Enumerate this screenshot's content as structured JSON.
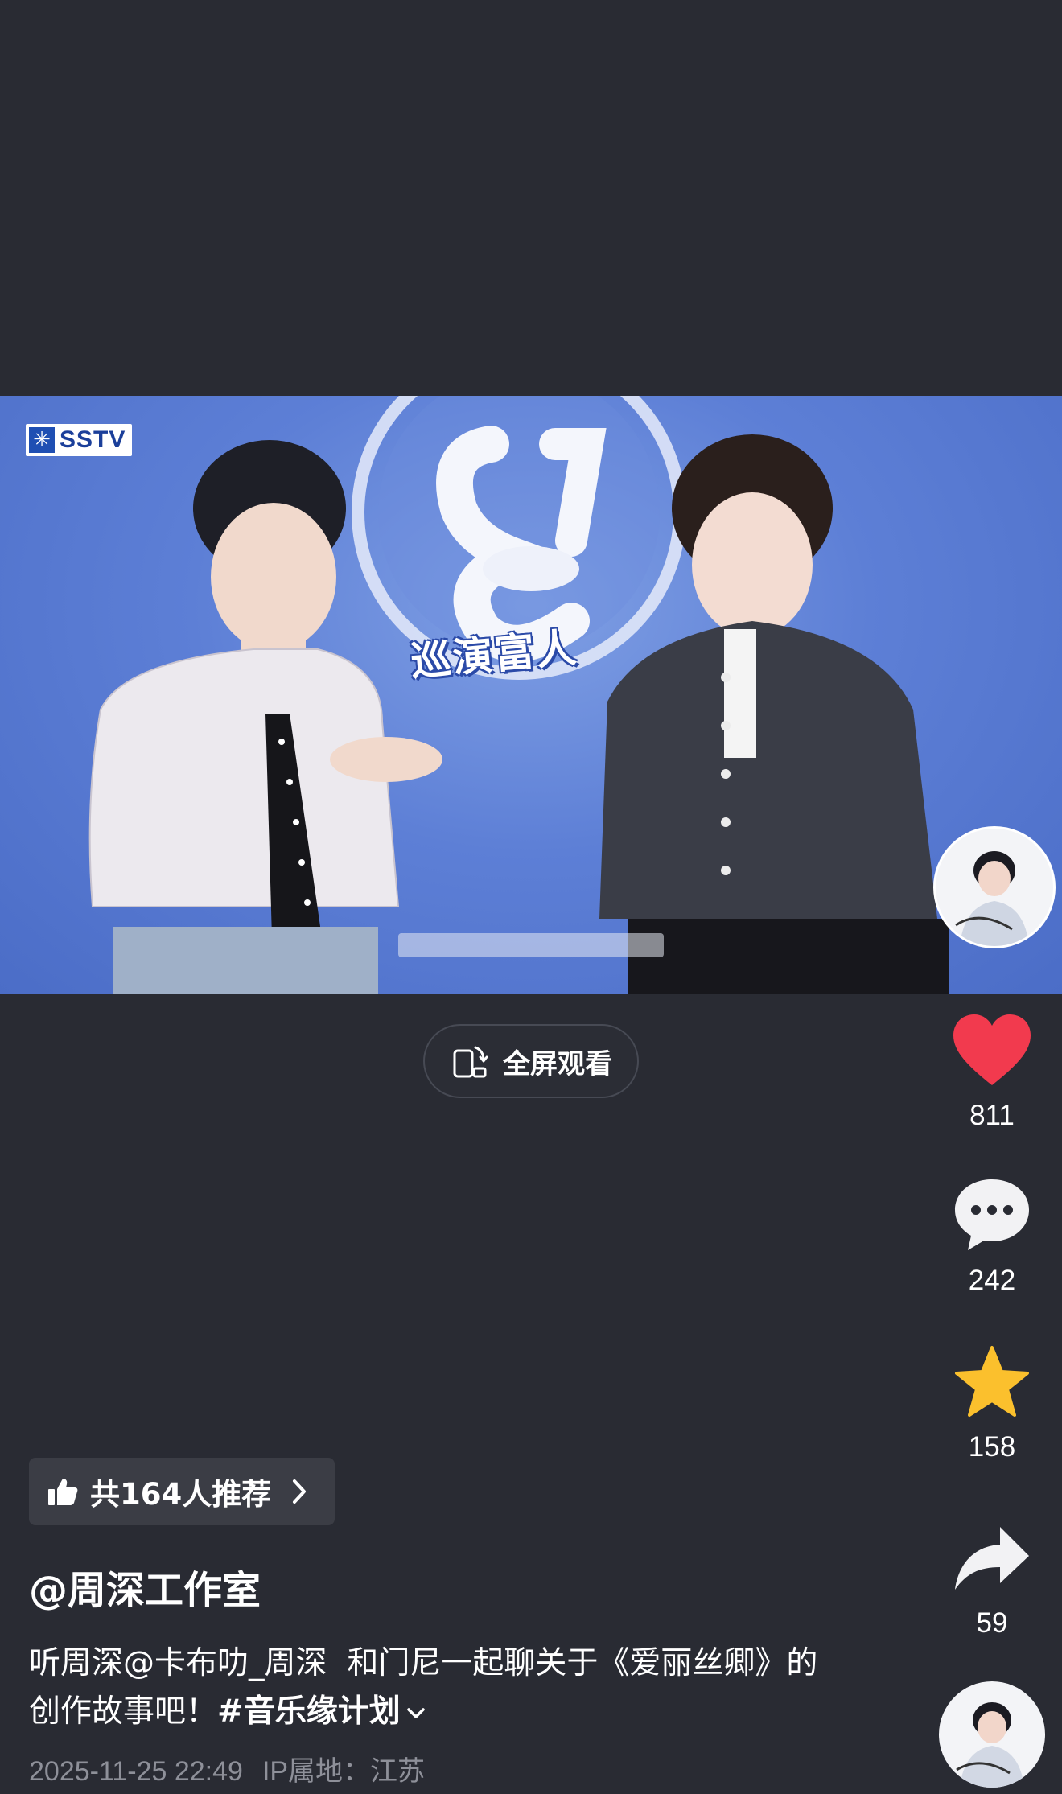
{
  "video": {
    "channel_logo": "SSTV",
    "show_title": "巡演富人"
  },
  "fullscreen": {
    "icon": "rotate-screen-icon",
    "label": "全屏观看"
  },
  "actions": {
    "like": {
      "icon": "heart-icon",
      "count": "811",
      "color": "#f23a4e"
    },
    "comment": {
      "icon": "comment-bubble-icon",
      "count": "242"
    },
    "favorite": {
      "icon": "star-icon",
      "count": "158",
      "color": "#fbc02d"
    },
    "share": {
      "icon": "share-arrow-icon",
      "count": "59"
    }
  },
  "recommend": {
    "icon": "thumbs-up-icon",
    "label": "共164人推荐"
  },
  "post": {
    "author": "@周深工作室",
    "caption_prefix": "听周深",
    "mention": "@卡布叻_周深",
    "caption_middle": "  和门尼一起聊关于《爱丽丝卿》的创作故事吧！",
    "hashtag": "#音乐缘计划",
    "date": "2025-11-25 22:49",
    "ip_location": "IP属地：江苏"
  },
  "colors": {
    "background": "#292b33",
    "video_bg": "#5d7fd6"
  }
}
